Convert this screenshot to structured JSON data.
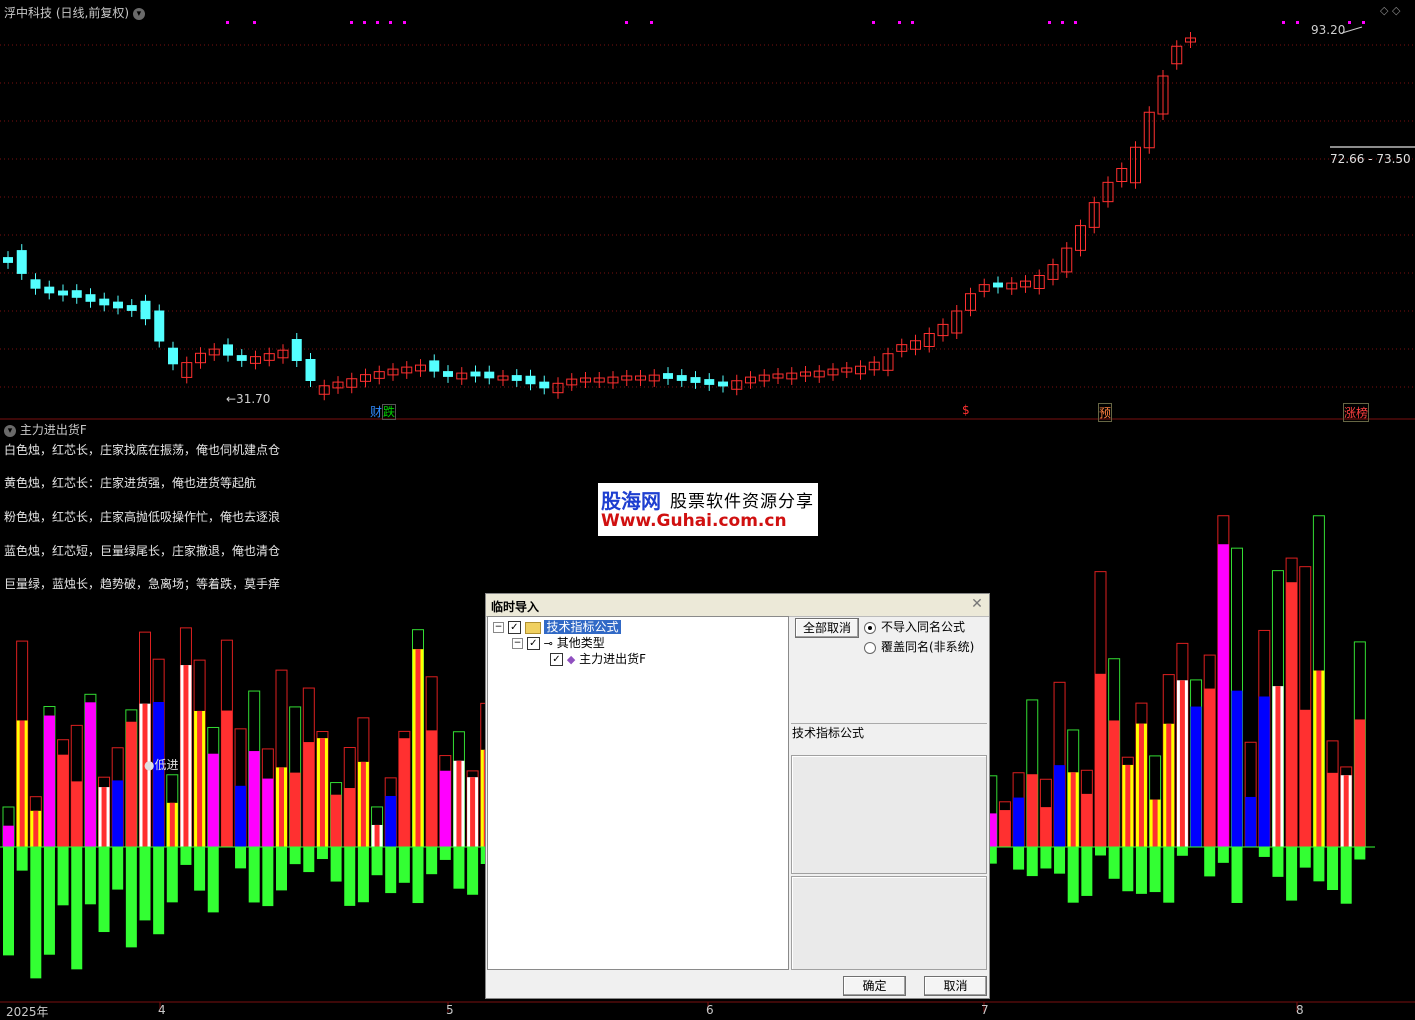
{
  "header": {
    "stock_title": "浮中科技",
    "period_label": "(日线,前复权)",
    "indicator_title": "主力进出货F"
  },
  "price_labels": {
    "high": "93.20",
    "low": "←31.70",
    "range": "72.66 - 73.50"
  },
  "event_markers": [
    {
      "text": "财",
      "color": "#2f8bff"
    },
    {
      "text": "跌",
      "color": "#00d000"
    },
    {
      "text": "$",
      "color": "#ff3030"
    },
    {
      "text": "预",
      "color": "#ff8040"
    },
    {
      "text": "涨榜",
      "color": "#ff4040"
    }
  ],
  "indicator_legend": [
    "白色烛，红芯长，庄家找底在振荡，俺也伺机建点仓",
    "黄色烛，红芯长：庄家进货强，俺也进货等起航",
    "粉色烛，红芯长，庄家高抛低吸操作忙，俺也去逐浪",
    "蓝色烛，红芯短，巨量绿尾长，庄家撤退，俺也清仓",
    "巨量绿，蓝烛长，趋势破，急离场；等着跌，莫手痒"
  ],
  "signal_label": "●低进",
  "x_axis_labels": [
    "2025年",
    "4",
    "5",
    "6",
    "7",
    "8"
  ],
  "watermark": {
    "brand": "股海网",
    "slogan": "股票软件资源分享",
    "url": "Www.Guhai.com.cn"
  },
  "dialog": {
    "title": "临时导入",
    "tree": {
      "root": "技术指标公式",
      "child": "其他类型",
      "leaf": "主力进出货F"
    },
    "deselect_all_button": "全部取消",
    "radio_options": [
      {
        "label": "不导入同名公式",
        "selected": true
      },
      {
        "label": "覆盖同名(非系统)",
        "selected": false
      }
    ],
    "info_label": "技术指标公式",
    "ok_button": "确定",
    "cancel_button": "取消"
  },
  "colors": {
    "up": "#ff3030",
    "down": "#54ffff",
    "white_bar": "#ffffff",
    "yellow_bar": "#ffff00",
    "pink_bar": "#ff00ff",
    "blue_bar": "#0000ff",
    "green_bar": "#33ff33",
    "magenta_dot": "#ff00ff"
  }
}
